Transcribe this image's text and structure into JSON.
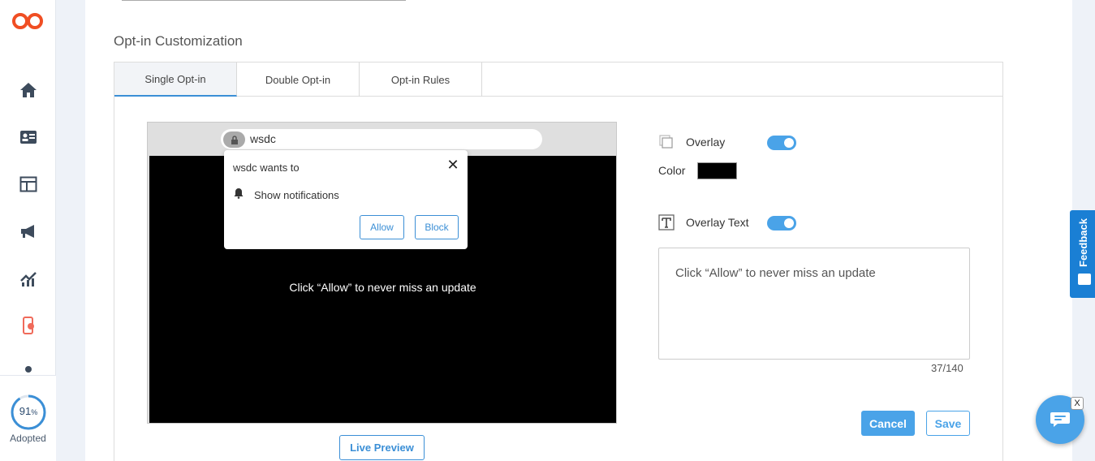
{
  "sidebar": {
    "adopted_percent": "91",
    "adopted_percent_symbol": "%",
    "adopted_label": "Adopted"
  },
  "section_title": "Opt-in Customization",
  "tabs": [
    {
      "label": "Single Opt-in",
      "active": true
    },
    {
      "label": "Double Opt-in",
      "active": false
    },
    {
      "label": "Opt-in Rules",
      "active": false
    }
  ],
  "preview": {
    "url": "wsdc",
    "popup_title": "wsdc wants to",
    "popup_notification": "Show notifications",
    "allow_label": "Allow",
    "block_label": "Block",
    "overlay_message": "Click “Allow” to never miss an update"
  },
  "live_preview_label": "Live Preview",
  "settings": {
    "overlay_label": "Overlay",
    "overlay_enabled": true,
    "color_label": "Color",
    "overlay_color": "#000000",
    "overlay_text_label": "Overlay Text",
    "overlay_text_enabled": true,
    "overlay_text_value": "Click “Allow” to never miss an update",
    "char_counter": "37/140",
    "cancel_label": "Cancel",
    "save_label": "Save"
  },
  "feedback_label": "Feedback",
  "chat_close_label": "X",
  "colors": {
    "accent": "#4aa3e8",
    "brand": "#f04e23",
    "feedback": "#1a7fd4"
  }
}
